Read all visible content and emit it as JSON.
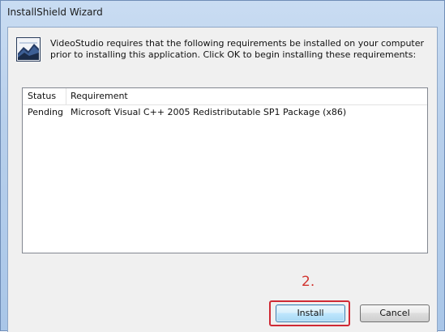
{
  "window": {
    "title": "InstallShield Wizard"
  },
  "header": {
    "message": "VideoStudio requires that the following requirements be installed on your computer prior to installing this application. Click OK to begin installing these requirements:"
  },
  "requirements_list": {
    "columns": [
      "Status",
      "Requirement"
    ],
    "rows": [
      {
        "status": "Pending",
        "requirement": "Microsoft Visual C++ 2005 Redistributable SP1 Package (x86)"
      }
    ]
  },
  "annotation": {
    "step_label": "2.",
    "color": "#d1342f"
  },
  "buttons": {
    "install_label": "Install",
    "cancel_label": "Cancel"
  },
  "icons": {
    "app_icon": "installshield-icon"
  }
}
